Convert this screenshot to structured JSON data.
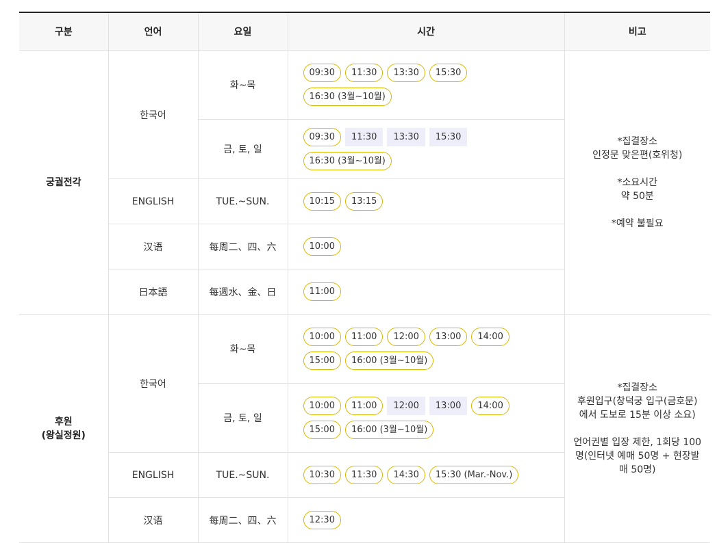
{
  "headers": {
    "category": "구분",
    "language": "언어",
    "day": "요일",
    "time": "시간",
    "note": "비고"
  },
  "section1": {
    "category": "궁궐전각",
    "note_lines": [
      "*집결장소",
      "인정문 맞은편(호위청)",
      "",
      "*소요시간",
      "약 50분",
      "",
      "*예약 불필요"
    ],
    "korean": {
      "language": "한국어",
      "row1": {
        "day": "화~목",
        "times": [
          "09:30",
          "11:30",
          "13:30",
          "15:30",
          "16:30 (3월~10월)"
        ]
      },
      "row2": {
        "day": "금, 토, 일",
        "times": [
          "09:30",
          "11:30",
          "13:30",
          "15:30",
          "16:30 (3월~10월)"
        ],
        "unavailable": [
          1,
          2,
          3
        ]
      }
    },
    "english": {
      "language": "ENGLISH",
      "day": "TUE.~SUN.",
      "times": [
        "10:15",
        "13:15"
      ]
    },
    "chinese": {
      "language": "汉语",
      "day": "每周二、四、六",
      "times": [
        "10:00"
      ]
    },
    "japanese": {
      "language": "日本語",
      "day": "每週水、金、日",
      "times": [
        "11:00"
      ]
    }
  },
  "section2": {
    "category_line1": "후원",
    "category_line2": "(왕실정원)",
    "note_lines": [
      "*집결장소",
      "후원입구(창덕궁 입구(금호문)",
      "에서 도보로 15분 이상 소요)",
      "",
      "언어권별 입장 제한, 1회당 100",
      "명(인터넷 예매 50명 + 현장발",
      "매 50명)"
    ],
    "korean": {
      "language": "한국어",
      "row1": {
        "day": "화~목",
        "times": [
          "10:00",
          "11:00",
          "12:00",
          "13:00",
          "14:00",
          "15:00",
          "16:00 (3월~10월)"
        ]
      },
      "row2": {
        "day": "금, 토, 일",
        "times": [
          "10:00",
          "11:00",
          "12:00",
          "13:00",
          "14:00",
          "15:00",
          "16:00 (3월~10월)"
        ],
        "unavailable": [
          2,
          3
        ]
      }
    },
    "english": {
      "language": "ENGLISH",
      "day": "TUE.~SUN.",
      "times": [
        "10:30",
        "11:30",
        "14:30",
        "15:30 (Mar.-Nov.)"
      ]
    },
    "chinese": {
      "language": "汉语",
      "day": "每周二、四、六",
      "times": [
        "12:30"
      ]
    }
  }
}
